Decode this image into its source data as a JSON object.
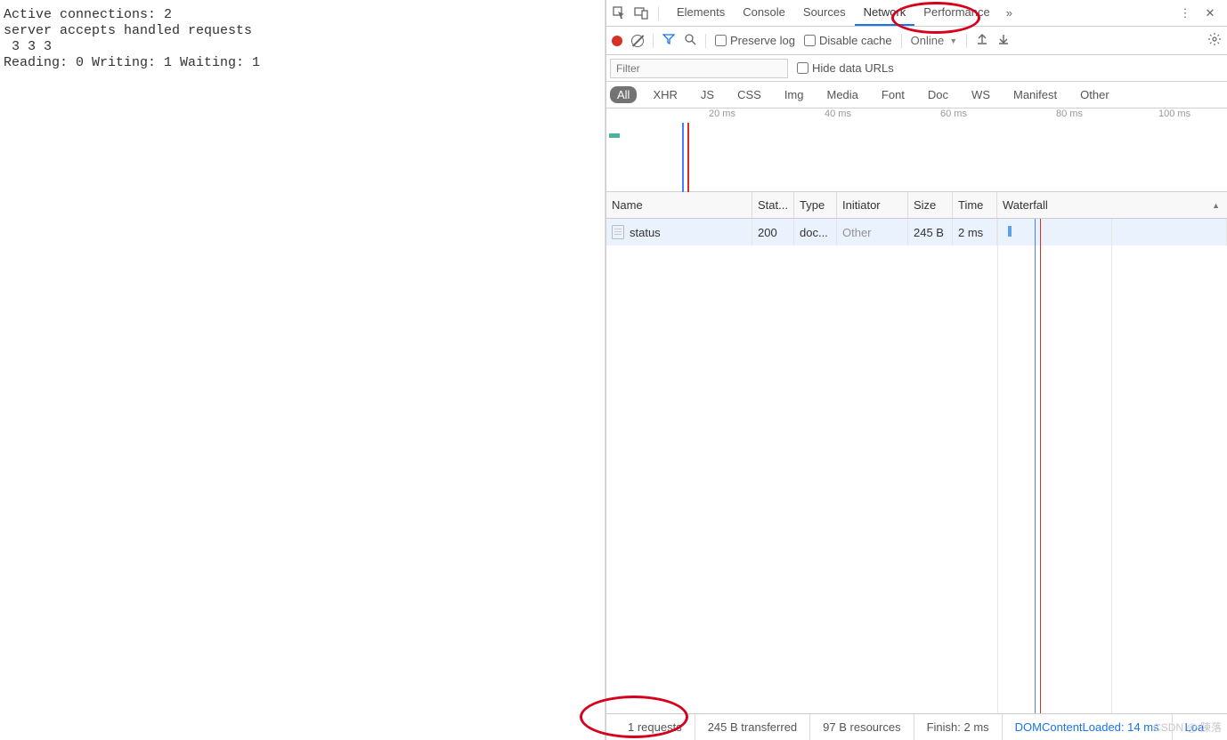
{
  "page_content": {
    "line1": "Active connections: 2",
    "line2": "server accepts handled requests",
    "line3": " 3 3 3",
    "line4": "Reading: 0 Writing: 1 Waiting: 1"
  },
  "tabbar": {
    "tabs": [
      "Elements",
      "Console",
      "Sources",
      "Network",
      "Performance"
    ],
    "active_index": 3
  },
  "toolbar": {
    "preserve_log": "Preserve log",
    "disable_cache": "Disable cache",
    "throttle": "Online"
  },
  "filter": {
    "placeholder": "Filter",
    "hide_data_urls": "Hide data URLs"
  },
  "types": [
    "All",
    "XHR",
    "JS",
    "CSS",
    "Img",
    "Media",
    "Font",
    "Doc",
    "WS",
    "Manifest",
    "Other"
  ],
  "types_active_index": 0,
  "overview": {
    "ticks": [
      "20 ms",
      "40 ms",
      "60 ms",
      "80 ms",
      "100 ms"
    ]
  },
  "columns": {
    "name": "Name",
    "status": "Stat...",
    "type": "Type",
    "initiator": "Initiator",
    "size": "Size",
    "time": "Time",
    "waterfall": "Waterfall"
  },
  "rows": [
    {
      "name": "status",
      "status": "200",
      "type": "doc...",
      "initiator": "Other",
      "size": "245 B",
      "time": "2 ms"
    }
  ],
  "summary": {
    "requests": "1 requests",
    "transferred": "245 B transferred",
    "resources": "97 B resources",
    "finish": "Finish: 2 ms",
    "dcl": "DOMContentLoaded: 14 ms",
    "load": "Loa"
  },
  "watermark": "CSDN @ 陳落"
}
